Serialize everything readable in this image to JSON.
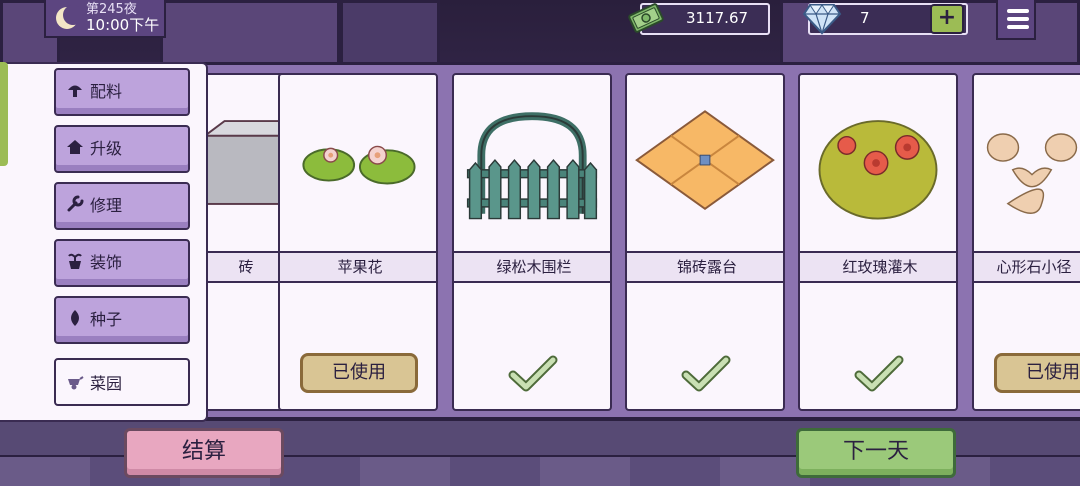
{
  "hud": {
    "night": "第245夜",
    "clock": "10:00下午",
    "money": "3117.67",
    "gems": "7",
    "add": "+"
  },
  "sidebar": {
    "items": [
      {
        "label": "配料",
        "icon": "mushroom-icon"
      },
      {
        "label": "升级",
        "icon": "home-icon"
      },
      {
        "label": "修理",
        "icon": "wrench-icon"
      },
      {
        "label": "装饰",
        "icon": "plant-pot-icon"
      },
      {
        "label": "种子",
        "icon": "seed-icon"
      },
      {
        "label": "菜园",
        "icon": "wheelbarrow-icon",
        "active": true
      }
    ]
  },
  "cards": [
    {
      "label": "砖",
      "status": "none"
    },
    {
      "label": "苹果花",
      "status": "used"
    },
    {
      "label": "绿松木围栏",
      "status": "check"
    },
    {
      "label": "锦砖露台",
      "status": "check"
    },
    {
      "label": "红玫瑰灌木",
      "status": "check"
    },
    {
      "label": "心形石小径",
      "status": "used"
    }
  ],
  "used_label": "已使用",
  "buttons": {
    "settle": "结算",
    "next_day": "下一天"
  }
}
